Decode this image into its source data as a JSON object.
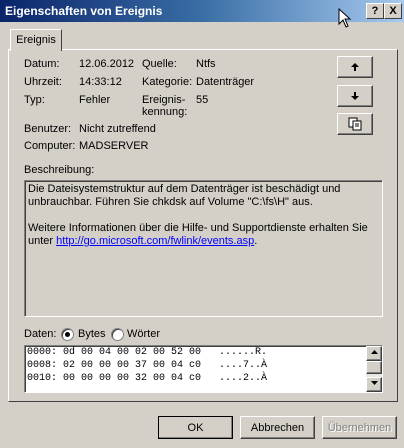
{
  "window": {
    "title": "Eigenschaften von Ereignis",
    "help_label": "?",
    "close_label": "X"
  },
  "tabs": [
    {
      "label": "Ereignis"
    }
  ],
  "fields": {
    "datum_label": "Datum:",
    "datum_value": "12.06.2012",
    "uhrzeit_label": "Uhrzeit:",
    "uhrzeit_value": "14:33:12",
    "typ_label": "Typ:",
    "typ_value": "Fehler",
    "quelle_label": "Quelle:",
    "quelle_value": "Ntfs",
    "kategorie_label": "Kategorie:",
    "kategorie_value": "Datenträger",
    "kennung_label_1": "Ereignis-",
    "kennung_label_2": "kennung:",
    "kennung_value": "55",
    "benutzer_label": "Benutzer:",
    "benutzer_value": "Nicht zutreffend",
    "computer_label": "Computer:",
    "computer_value": "MADSERVER"
  },
  "side_buttons": {
    "up_icon": "arrow-up-icon",
    "down_icon": "arrow-down-icon",
    "copy_icon": "copy-icon"
  },
  "description": {
    "label": "Beschreibung:",
    "paragraph1": "Die Dateisystemstruktur auf dem Datenträger ist beschädigt und unbrauchbar. Führen Sie chkdsk auf Volume \"C:\\fs\\H\" aus.",
    "paragraph2_text": "Weitere Informationen über die Hilfe- und Supportdienste erhalten Sie unter ",
    "link": "http://go.microsoft.com/fwlink/events.asp",
    "paragraph2_end": "."
  },
  "data": {
    "label": "Daten:",
    "options": [
      {
        "label": "Bytes",
        "selected": true
      },
      {
        "label": "Wörter",
        "selected": false
      }
    ],
    "lines": [
      "0000: 0d 00 04 00 02 00 52 00   ......R.",
      "0008: 02 00 00 00 37 00 04 c0   ....7..À",
      "0010: 00 00 00 00 32 00 04 c0   ....2..À"
    ]
  },
  "buttons": {
    "ok": "OK",
    "cancel": "Abbrechen",
    "apply": "Übernehmen"
  }
}
